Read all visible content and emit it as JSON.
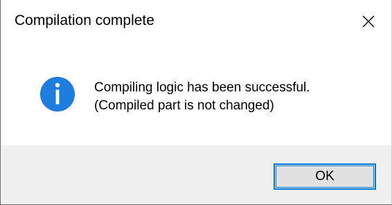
{
  "dialog": {
    "title": "Compilation complete",
    "message_line1": "Compiling logic has been successful.",
    "message_line2": "(Compiled part is not changed)",
    "icon": "info-icon",
    "ok_label": "OK",
    "close_icon": "close-icon"
  },
  "colors": {
    "accent": "#0078d7",
    "footer_bg": "#f0f0f0",
    "button_bg": "#e1e1e1"
  }
}
